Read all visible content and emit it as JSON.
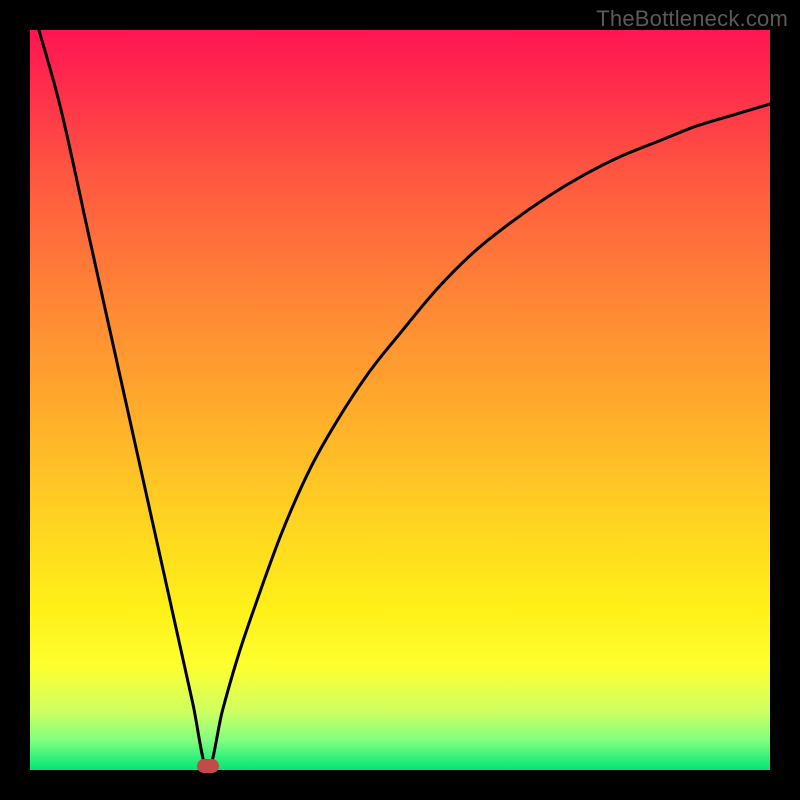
{
  "watermark": "TheBottleneck.com",
  "colors": {
    "curve": "#000000",
    "marker": "#c44a4a"
  },
  "chart_data": {
    "type": "line",
    "title": "",
    "xlabel": "",
    "ylabel": "",
    "xlim": [
      0,
      100
    ],
    "ylim": [
      0,
      100
    ],
    "annotations": [
      {
        "type": "marker",
        "x": 24,
        "y": 0,
        "label": "bottleneck-minimum"
      }
    ],
    "series": [
      {
        "name": "bottleneck-curve",
        "x": [
          0,
          4,
          8,
          12,
          16,
          20,
          22,
          24,
          26,
          28,
          30,
          34,
          38,
          42,
          46,
          50,
          55,
          60,
          65,
          70,
          75,
          80,
          85,
          90,
          95,
          100
        ],
        "values": [
          108,
          90,
          72,
          54,
          36,
          18,
          9,
          0,
          8,
          15,
          21,
          32,
          41,
          48,
          54,
          59,
          65,
          70,
          74,
          77.5,
          80.5,
          83,
          85,
          87,
          88.5,
          90
        ]
      }
    ]
  }
}
